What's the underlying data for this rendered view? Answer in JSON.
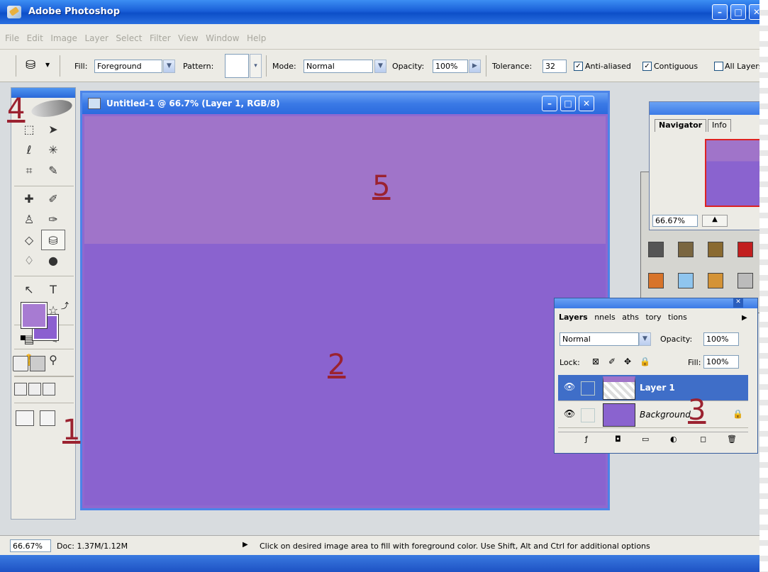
{
  "app": {
    "title": "Adobe Photoshop"
  },
  "menu": [
    "File",
    "Edit",
    "Image",
    "Layer",
    "Select",
    "Filter",
    "View",
    "Window",
    "Help"
  ],
  "options": {
    "fill_label": "Fill:",
    "fill_value": "Foreground",
    "pattern_label": "Pattern:",
    "mode_label": "Mode:",
    "mode_value": "Normal",
    "opacity_label": "Opacity:",
    "opacity_value": "100%",
    "tolerance_label": "Tolerance:",
    "tolerance_value": "32",
    "anti_aliased": "Anti-aliased",
    "contiguous": "Contiguous",
    "all_layers": "All Layers"
  },
  "document": {
    "title": "Untitled-1 @ 66.7% (Layer 1, RGB/8)"
  },
  "navigator": {
    "tabs": [
      "Navigator",
      "Info"
    ],
    "zoom": "66.67%"
  },
  "layers": {
    "tabs": [
      "Layers",
      "nnels",
      "aths",
      "tory",
      "tions"
    ],
    "blend_mode": "Normal",
    "opacity_label": "Opacity:",
    "opacity_value": "100%",
    "lock_label": "Lock:",
    "fill_label": "Fill:",
    "fill_value": "100%",
    "rows": [
      {
        "name": "Layer 1"
      },
      {
        "name": "Background"
      }
    ]
  },
  "status": {
    "zoom": "66.67%",
    "doc": "Doc: 1.37M/1.12M",
    "hint": "Click on desired image area to fill with foreground color.  Use Shift, Alt and Ctrl for additional options"
  },
  "annotations": [
    "1",
    "2",
    "3",
    "4",
    "5"
  ],
  "colors": {
    "foreground": "#a77bd2",
    "background": "#8b5fd0",
    "canvas_top": "#a074c9",
    "canvas_bottom": "#8a63cf",
    "annotation": "#9b2230"
  }
}
